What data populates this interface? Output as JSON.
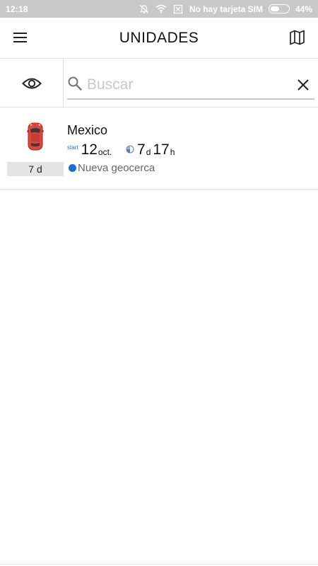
{
  "status_bar": {
    "time": "12:18",
    "carrier": "No hay tarjeta SIM",
    "battery_text": "44%",
    "battery_level": 0.44,
    "icons": [
      "bell-off-icon",
      "wifi-icon",
      "no-sim-icon",
      "battery-icon"
    ]
  },
  "app_bar": {
    "title": "UNIDADES",
    "left_icon": "menu-icon",
    "right_icon": "map-icon"
  },
  "search": {
    "placeholder": "Buscar",
    "value": "",
    "left_icon": "eye-icon",
    "clear_icon": "close-icon"
  },
  "units": [
    {
      "name": "Mexico",
      "badge": "7 d",
      "start_label": "start",
      "start_day": "12",
      "start_month": "oct.",
      "duration_days": "7",
      "duration_days_unit": "d",
      "duration_hours": "17",
      "duration_hours_unit": "h",
      "geofence": "Nueva geocerca",
      "icon": "car-icon",
      "colors": {
        "car": "#e0453c",
        "geofence_dot": "#1a6fd6",
        "start_label": "#1a6fd6"
      }
    }
  ]
}
